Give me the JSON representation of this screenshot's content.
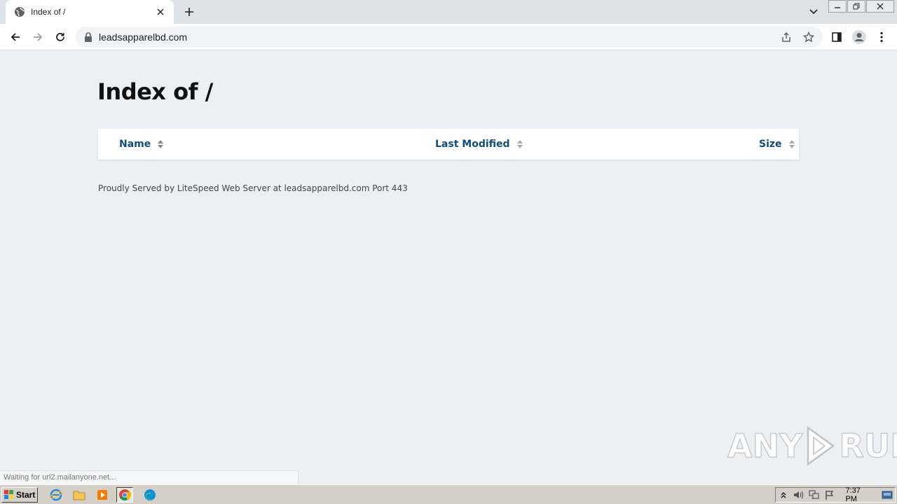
{
  "browser": {
    "tab": {
      "title": "Index of /",
      "favicon": "globe-icon"
    },
    "omnibox": {
      "url": "leadsapparelbd.com"
    }
  },
  "page": {
    "title": "Index of /",
    "columns": [
      {
        "label": "Name"
      },
      {
        "label": "Last Modified"
      },
      {
        "label": "Size"
      }
    ],
    "footer": "Proudly Served by LiteSpeed Web Server at leadsapparelbd.com Port 443"
  },
  "status_bar": {
    "text": "Waiting for url2.mailanyone.net..."
  },
  "watermark": {
    "left": "ANY",
    "right": "RUN"
  },
  "taskbar": {
    "start_label": "Start",
    "clock": "7:37 PM"
  },
  "colors": {
    "link_blue": "#0f4c81",
    "page_bg": "#edf0f3",
    "taskbar_bg": "#d4d0c8"
  }
}
